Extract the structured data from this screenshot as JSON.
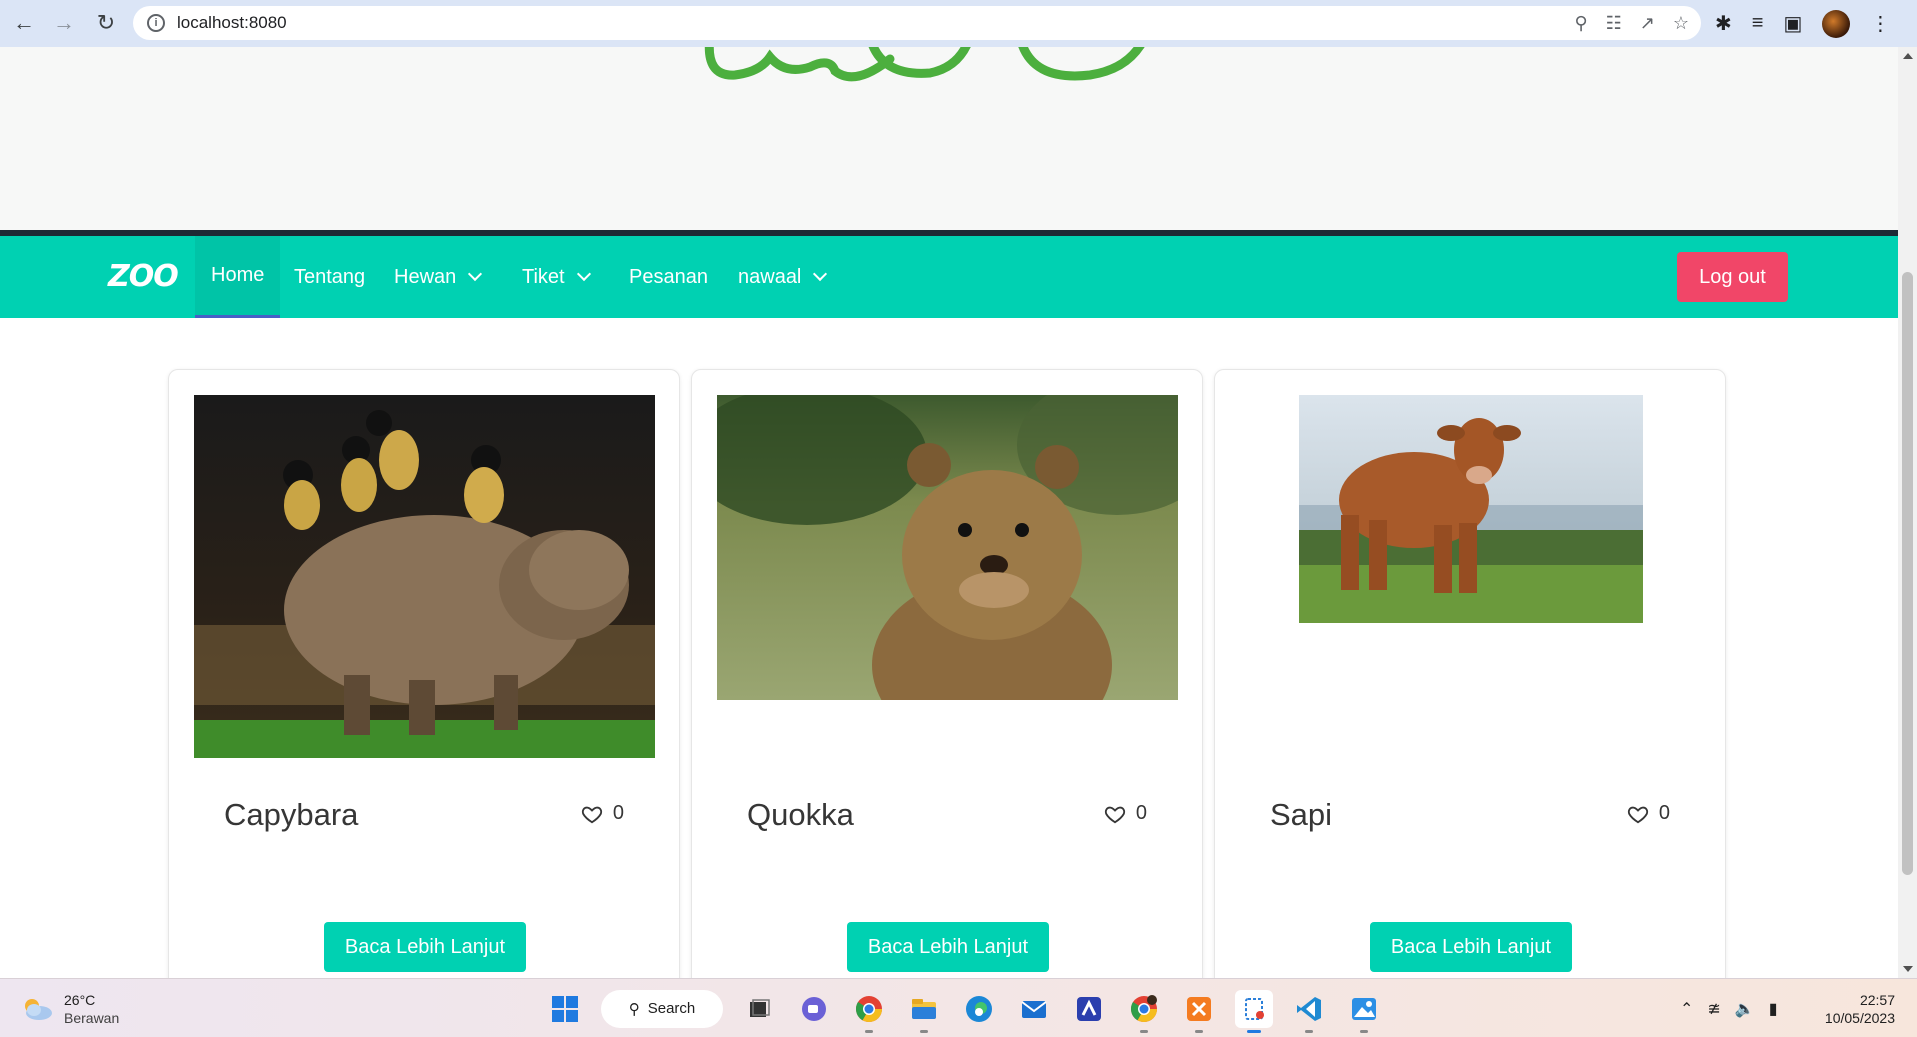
{
  "browser": {
    "url": "localhost:8080",
    "back_icon": "arrow-left-icon",
    "forward_icon": "arrow-right-icon",
    "reload_icon": "reload-icon"
  },
  "navbar": {
    "logo": "ZOO",
    "items": [
      {
        "label": "Home",
        "active": true
      },
      {
        "label": "Tentang"
      },
      {
        "label": "Hewan",
        "dropdown": true
      },
      {
        "label": "Tiket",
        "dropdown": true
      },
      {
        "label": "Pesanan"
      },
      {
        "label": "nawaal",
        "dropdown": true
      }
    ],
    "logout_label": "Log out"
  },
  "cards": [
    {
      "name": "Capybara",
      "likes": "0",
      "button": "Baca Lebih Lanjut"
    },
    {
      "name": "Quokka",
      "likes": "0",
      "button": "Baca Lebih Lanjut"
    },
    {
      "name": "Sapi",
      "likes": "0",
      "button": "Baca Lebih Lanjut"
    }
  ],
  "taskbar": {
    "weather_temp": "26°C",
    "weather_cond": "Berawan",
    "search_label": "Search",
    "time": "22:57",
    "date": "10/05/2023"
  },
  "colors": {
    "primary": "#00d1b2",
    "danger": "#f14668",
    "dark_border": "#1e2a35"
  }
}
